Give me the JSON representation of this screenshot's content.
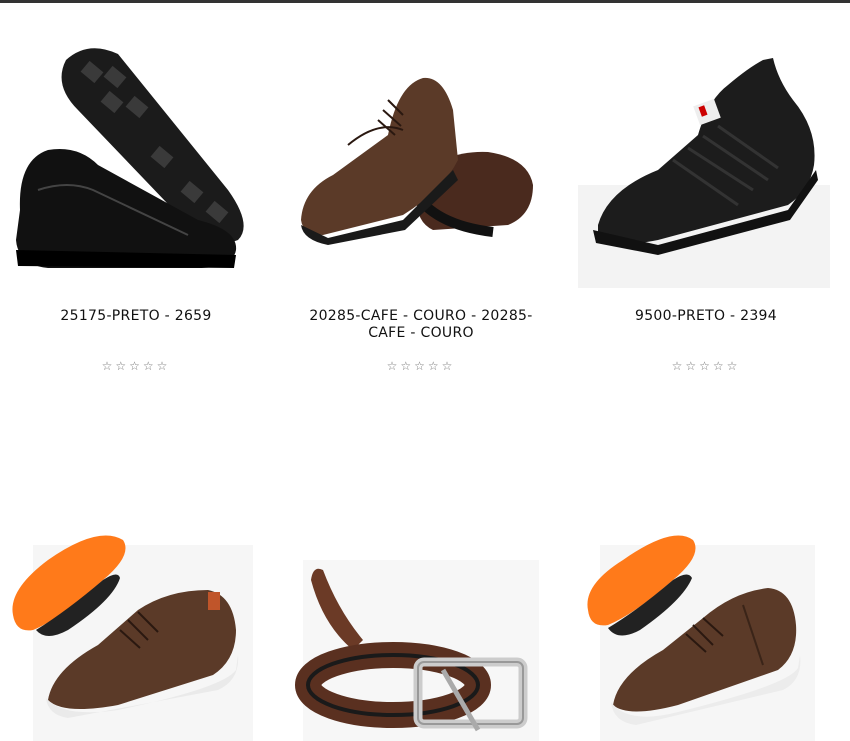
{
  "products": [
    {
      "name": "25175-PRETO - 2659",
      "rating_stars": 0,
      "rating_max": 5,
      "image": "black-slip-on-shoes"
    },
    {
      "name": "20285-CAFE - COURO - 20285-CAFE - COURO",
      "rating_stars": 0,
      "rating_max": 5,
      "image": "brown-oxford-shoes"
    },
    {
      "name": "9500-PRETO - 2394",
      "rating_stars": 0,
      "rating_max": 5,
      "image": "black-knit-sneaker"
    },
    {
      "name": "",
      "image": "brown-sneaker-orange-insole"
    },
    {
      "name": "",
      "image": "brown-leather-belt"
    },
    {
      "name": "",
      "image": "brown-zip-sneaker-orange-insole"
    }
  ],
  "star_glyph": "☆",
  "colors": {
    "top_bar": "#333333",
    "insole_orange": "#ff7a1a",
    "leather_brown": "#5b3a28",
    "shoe_black": "#1a1a1a"
  }
}
